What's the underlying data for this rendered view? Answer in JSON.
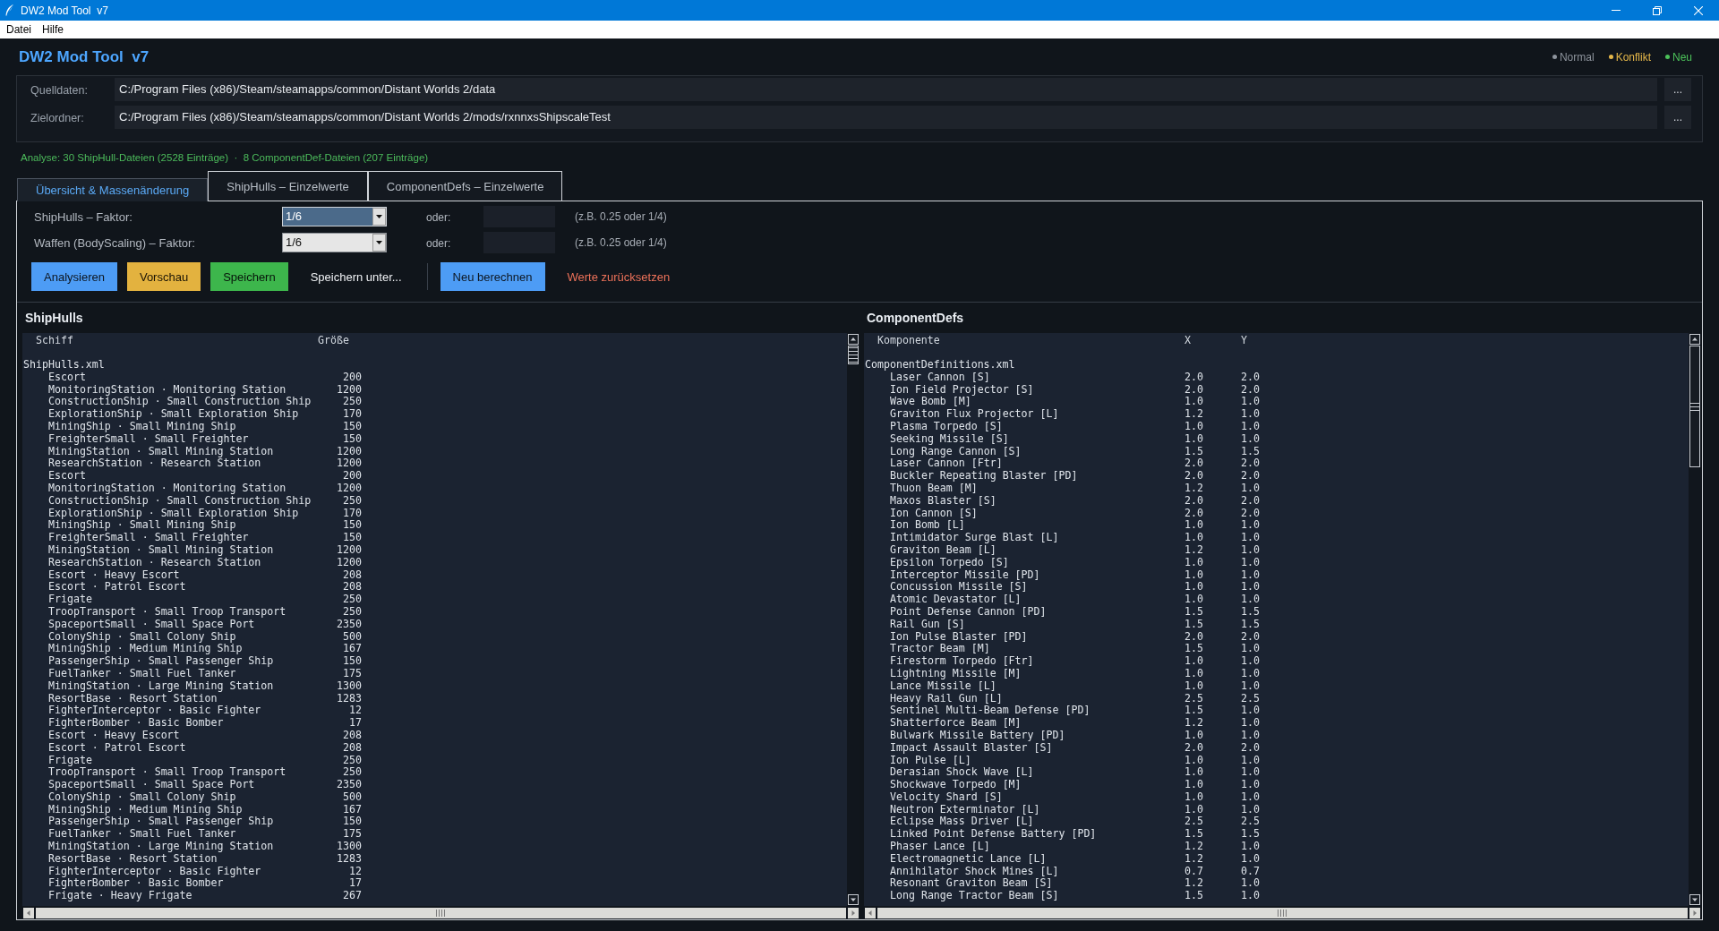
{
  "window": {
    "title": "DW2 Mod Tool  v7"
  },
  "menu": [
    "Datei",
    "Hilfe"
  ],
  "header": {
    "title": "DW2 Mod Tool  v7",
    "legend": [
      {
        "label": "Normal",
        "color": "#8d939c"
      },
      {
        "label": "Konflikt",
        "color": "#e6b84a"
      },
      {
        "label": "Neu",
        "color": "#4cc25a"
      }
    ]
  },
  "paths": [
    {
      "label": "Quelldaten:",
      "value": "C:/Program Files (x86)/Steam/steamapps/common/Distant Worlds 2/data",
      "button": "..."
    },
    {
      "label": "Zielordner:",
      "value": "C:/Program Files (x86)/Steam/steamapps/common/Distant Worlds 2/mods/rxnnxsShipscaleTest",
      "button": "..."
    }
  ],
  "analysis_summary": "Analyse: 30 ShipHull-Dateien (2528 Einträge)  ·  8 ComponentDef-Dateien (207 Einträge)",
  "tabs": [
    {
      "label": "Übersicht & Massenänderung",
      "selected": true
    },
    {
      "label": "ShipHulls – Einzelwerte",
      "selected": false
    },
    {
      "label": "ComponentDefs – Einzelwerte",
      "selected": false
    }
  ],
  "factors": [
    {
      "label": "ShipHulls – Faktor:",
      "value": "1/6",
      "focused": true,
      "alt_label": "oder:",
      "hint": "(z.B. 0.25 oder 1/4)"
    },
    {
      "label": "Waffen (BodyScaling) – Faktor:",
      "value": "1/6",
      "focused": false,
      "alt_label": "oder:",
      "hint": "(z.B. 0.25 oder 1/4)"
    }
  ],
  "action_groups": [
    {
      "buttons": [
        {
          "label": "Analysieren",
          "kind": "primary"
        },
        {
          "label": "Vorschau",
          "kind": "warning"
        },
        {
          "label": "Speichern",
          "kind": "success"
        },
        {
          "label": "Speichern unter...",
          "kind": "plain"
        }
      ]
    },
    {
      "buttons": [
        {
          "label": "Neu berechnen",
          "kind": "primary"
        },
        {
          "label": "Werte zurücksetzen",
          "kind": "danger"
        }
      ]
    }
  ],
  "panels": [
    {
      "title": "ShipHulls",
      "kind": "hull_sizes",
      "columns": [
        "Schiff",
        "Größe"
      ],
      "groups": [
        {
          "label": "ShipHulls.xml",
          "children": [
            {
              "cells": [
                "Escort",
                "200"
              ]
            },
            {
              "cells": [
                "MonitoringStation · Monitoring Station",
                "1200"
              ]
            },
            {
              "cells": [
                "ConstructionShip · Small Construction Ship",
                "250"
              ]
            },
            {
              "cells": [
                "ExplorationShip · Small Exploration Ship",
                "170"
              ]
            },
            {
              "cells": [
                "MiningShip · Small Mining Ship",
                "150"
              ]
            },
            {
              "cells": [
                "FreighterSmall · Small Freighter",
                "150"
              ]
            },
            {
              "cells": [
                "MiningStation · Small Mining Station",
                "1200"
              ]
            },
            {
              "cells": [
                "ResearchStation · Research Station",
                "1200"
              ]
            },
            {
              "cells": [
                "Escort",
                "200"
              ]
            },
            {
              "cells": [
                "MonitoringStation · Monitoring Station",
                "1200"
              ]
            },
            {
              "cells": [
                "ConstructionShip · Small Construction Ship",
                "250"
              ]
            },
            {
              "cells": [
                "ExplorationShip · Small Exploration Ship",
                "170"
              ]
            },
            {
              "cells": [
                "MiningShip · Small Mining Ship",
                "150"
              ]
            },
            {
              "cells": [
                "FreighterSmall · Small Freighter",
                "150"
              ]
            },
            {
              "cells": [
                "MiningStation · Small Mining Station",
                "1200"
              ]
            },
            {
              "cells": [
                "ResearchStation · Research Station",
                "1200"
              ]
            },
            {
              "cells": [
                "Escort · Heavy Escort",
                "208"
              ]
            },
            {
              "cells": [
                "Escort · Patrol Escort",
                "208"
              ]
            },
            {
              "cells": [
                "Frigate",
                "250"
              ]
            },
            {
              "cells": [
                "TroopTransport · Small Troop Transport",
                "250"
              ]
            },
            {
              "cells": [
                "SpaceportSmall · Small Space Port",
                "2350"
              ]
            },
            {
              "cells": [
                "ColonyShip · Small Colony Ship",
                "500"
              ]
            },
            {
              "cells": [
                "MiningShip · Medium Mining Ship",
                "167"
              ]
            },
            {
              "cells": [
                "PassengerShip · Small Passenger Ship",
                "150"
              ]
            },
            {
              "cells": [
                "FuelTanker · Small Fuel Tanker",
                "175"
              ]
            },
            {
              "cells": [
                "MiningStation · Large Mining Station",
                "1300"
              ]
            },
            {
              "cells": [
                "ResortBase · Resort Station",
                "1283"
              ]
            },
            {
              "cells": [
                "FighterInterceptor · Basic Fighter",
                "12"
              ]
            },
            {
              "cells": [
                "FighterBomber · Basic Bomber",
                "17"
              ]
            },
            {
              "cells": [
                "Escort · Heavy Escort",
                "208"
              ]
            },
            {
              "cells": [
                "Escort · Patrol Escort",
                "208"
              ]
            },
            {
              "cells": [
                "Frigate",
                "250"
              ]
            },
            {
              "cells": [
                "TroopTransport · Small Troop Transport",
                "250"
              ]
            },
            {
              "cells": [
                "SpaceportSmall · Small Space Port",
                "2350"
              ]
            },
            {
              "cells": [
                "ColonyShip · Small Colony Ship",
                "500"
              ]
            },
            {
              "cells": [
                "MiningShip · Medium Mining Ship",
                "167"
              ]
            },
            {
              "cells": [
                "PassengerShip · Small Passenger Ship",
                "150"
              ]
            },
            {
              "cells": [
                "FuelTanker · Small Fuel Tanker",
                "175"
              ]
            },
            {
              "cells": [
                "MiningStation · Large Mining Station",
                "1300"
              ]
            },
            {
              "cells": [
                "ResortBase · Resort Station",
                "1283"
              ]
            },
            {
              "cells": [
                "FighterInterceptor · Basic Fighter",
                "12"
              ]
            },
            {
              "cells": [
                "FighterBomber · Basic Bomber",
                "17"
              ]
            },
            {
              "cells": [
                "Frigate · Heavy Frigate",
                "267"
              ]
            }
          ]
        }
      ]
    },
    {
      "title": "ComponentDefs",
      "kind": "component_scales",
      "columns": [
        "Komponente",
        "X",
        "Y"
      ],
      "groups": [
        {
          "label": "ComponentDefinitions.xml",
          "children": [
            {
              "cells": [
                "Laser Cannon [S]",
                "2.0",
                "2.0"
              ]
            },
            {
              "cells": [
                "Ion Field Projector [S]",
                "2.0",
                "2.0"
              ]
            },
            {
              "cells": [
                "Wave Bomb [M]",
                "1.0",
                "1.0"
              ]
            },
            {
              "cells": [
                "Graviton Flux Projector [L]",
                "1.2",
                "1.0"
              ]
            },
            {
              "cells": [
                "Plasma Torpedo [S]",
                "1.0",
                "1.0"
              ]
            },
            {
              "cells": [
                "Seeking Missile [S]",
                "1.0",
                "1.0"
              ]
            },
            {
              "cells": [
                "Long Range Cannon [S]",
                "1.5",
                "1.5"
              ]
            },
            {
              "cells": [
                "Laser Cannon [Ftr]",
                "2.0",
                "2.0"
              ]
            },
            {
              "cells": [
                "Buckler Repeating Blaster [PD]",
                "2.0",
                "2.0"
              ]
            },
            {
              "cells": [
                "Thuon Beam [M]",
                "1.2",
                "1.0"
              ]
            },
            {
              "cells": [
                "Maxos Blaster [S]",
                "2.0",
                "2.0"
              ]
            },
            {
              "cells": [
                "Ion Cannon [S]",
                "2.0",
                "2.0"
              ]
            },
            {
              "cells": [
                "Ion Bomb [L]",
                "1.0",
                "1.0"
              ]
            },
            {
              "cells": [
                "Intimidator Surge Blast [L]",
                "1.0",
                "1.0"
              ]
            },
            {
              "cells": [
                "Graviton Beam [L]",
                "1.2",
                "1.0"
              ]
            },
            {
              "cells": [
                "Epsilon Torpedo [S]",
                "1.0",
                "1.0"
              ]
            },
            {
              "cells": [
                "Interceptor Missile [PD]",
                "1.0",
                "1.0"
              ]
            },
            {
              "cells": [
                "Concussion Missile [S]",
                "1.0",
                "1.0"
              ]
            },
            {
              "cells": [
                "Atomic Devastator [L]",
                "1.0",
                "1.0"
              ]
            },
            {
              "cells": [
                "Point Defense Cannon [PD]",
                "1.5",
                "1.5"
              ]
            },
            {
              "cells": [
                "Rail Gun [S]",
                "1.5",
                "1.5"
              ]
            },
            {
              "cells": [
                "Ion Pulse Blaster [PD]",
                "2.0",
                "2.0"
              ]
            },
            {
              "cells": [
                "Tractor Beam [M]",
                "1.5",
                "1.0"
              ]
            },
            {
              "cells": [
                "Firestorm Torpedo [Ftr]",
                "1.0",
                "1.0"
              ]
            },
            {
              "cells": [
                "Lightning Missile [M]",
                "1.0",
                "1.0"
              ]
            },
            {
              "cells": [
                "Lance Missile [L]",
                "1.0",
                "1.0"
              ]
            },
            {
              "cells": [
                "Heavy Rail Gun [L]",
                "2.5",
                "2.5"
              ]
            },
            {
              "cells": [
                "Sentinel Multi-Beam Defense [PD]",
                "1.5",
                "1.0"
              ]
            },
            {
              "cells": [
                "Shatterforce Beam [M]",
                "1.2",
                "1.0"
              ]
            },
            {
              "cells": [
                "Bulwark Missile Battery [PD]",
                "1.0",
                "1.0"
              ]
            },
            {
              "cells": [
                "Impact Assault Blaster [S]",
                "2.0",
                "2.0"
              ]
            },
            {
              "cells": [
                "Ion Pulse [L]",
                "1.0",
                "1.0"
              ]
            },
            {
              "cells": [
                "Derasian Shock Wave [L]",
                "1.0",
                "1.0"
              ]
            },
            {
              "cells": [
                "Shockwave Torpedo [M]",
                "1.0",
                "1.0"
              ]
            },
            {
              "cells": [
                "Velocity Shard [S]",
                "1.0",
                "1.0"
              ]
            },
            {
              "cells": [
                "Neutron Exterminator [L]",
                "1.0",
                "1.0"
              ]
            },
            {
              "cells": [
                "Eclipse Mass Driver [L]",
                "2.5",
                "2.5"
              ]
            },
            {
              "cells": [
                "Linked Point Defense Battery [PD]",
                "1.5",
                "1.5"
              ]
            },
            {
              "cells": [
                "Phaser Lance [L]",
                "1.2",
                "1.0"
              ]
            },
            {
              "cells": [
                "Electromagnetic Lance [L]",
                "1.2",
                "1.0"
              ]
            },
            {
              "cells": [
                "Annihilator Shock Mines [L]",
                "0.7",
                "0.7"
              ]
            },
            {
              "cells": [
                "Resonant Graviton Beam [S]",
                "1.2",
                "1.0"
              ]
            },
            {
              "cells": [
                "Long Range Tractor Beam [S]",
                "1.5",
                "1.0"
              ]
            }
          ]
        }
      ]
    }
  ]
}
